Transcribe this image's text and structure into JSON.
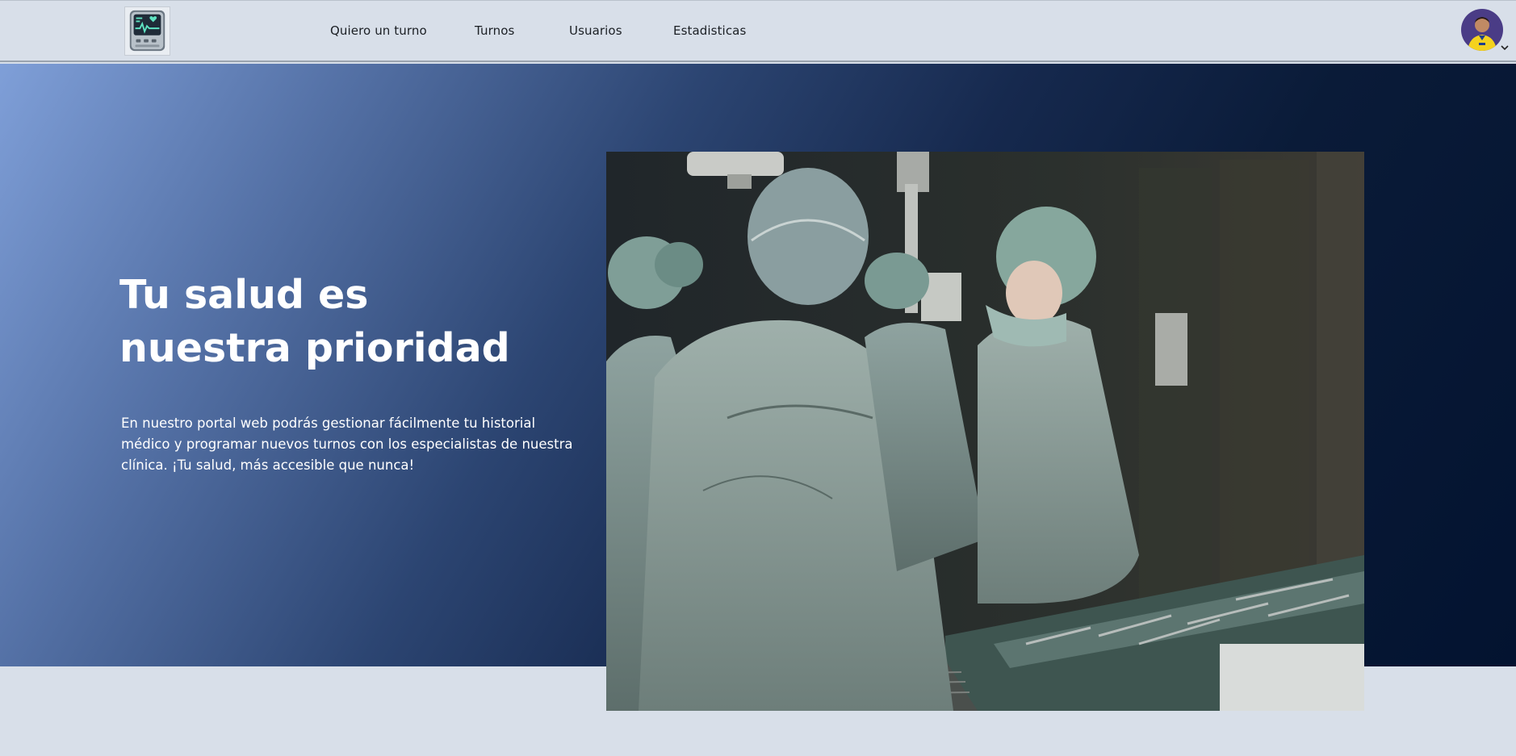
{
  "nav": {
    "logo_icon": "heart-monitor-icon",
    "links": [
      {
        "label": "Quiero un turno"
      },
      {
        "label": "Turnos"
      },
      {
        "label": "Usuarios"
      },
      {
        "label": "Estadisticas"
      }
    ],
    "avatar_icon": "user-avatar",
    "caret_icon": "chevron-down-icon"
  },
  "hero": {
    "title": "Tu salud es nuestra prioridad",
    "description": "En nuestro portal web podrás gestionar fácilmente tu historial médico y programar nuevos turnos con los especialistas de nuestra clínica. ¡Tu salud, más accesible que nunca!",
    "image_icon": "surgeons-photo"
  },
  "colors": {
    "page_bg": "#d8dfe9",
    "hero_gradient_start": "#7f9fd8",
    "hero_gradient_end": "#031330",
    "text_light": "#ffffff",
    "nav_text": "#1b1f24"
  }
}
